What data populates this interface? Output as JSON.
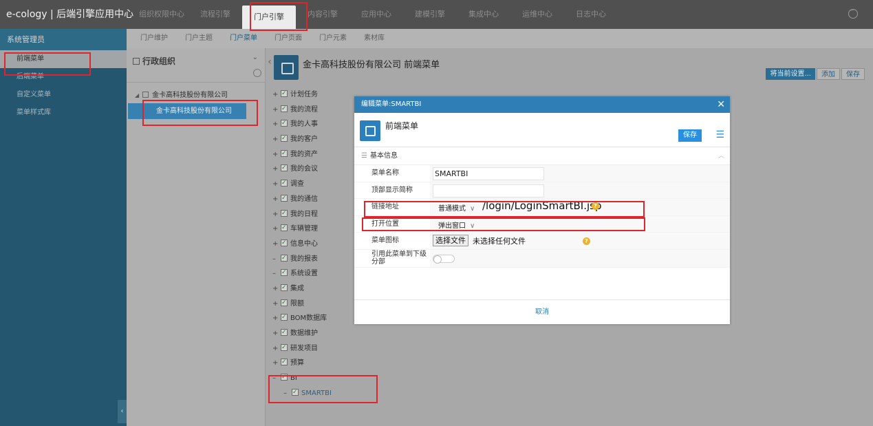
{
  "app": {
    "title": "e-cology | 后端引擎应用中心"
  },
  "topnav": {
    "tabs": [
      "组织权限中心",
      "流程引擎",
      "门户引擎",
      "内容引擎",
      "应用中心",
      "建模引擎",
      "集成中心",
      "运维中心",
      "日志中心"
    ],
    "active": "门户引擎"
  },
  "sidebar": {
    "title": "系统管理员",
    "items": [
      "前端菜单",
      "后端菜单",
      "自定义菜单",
      "菜单样式库"
    ]
  },
  "subnav": {
    "items": [
      "门户维护",
      "门户主题",
      "门户菜单",
      "门户页面",
      "门户元素",
      "素材库"
    ],
    "active": "门户菜单"
  },
  "org": {
    "title": "行政组织",
    "root": "金卡高科技股份有限公司",
    "selected": "金卡高科技股份有限公司"
  },
  "main": {
    "title": "金卡高科技股份有限公司 前端菜单",
    "buttons": [
      "将当前设置...",
      "添加",
      "保存"
    ]
  },
  "menu_tree": {
    "nodes": [
      {
        "pm": "+",
        "label": "计划任务"
      },
      {
        "pm": "+",
        "label": "我的流程"
      },
      {
        "pm": "+",
        "label": "我的人事"
      },
      {
        "pm": "+",
        "label": "我的客户"
      },
      {
        "pm": "+",
        "label": "我的资产"
      },
      {
        "pm": "+",
        "label": "我的会议"
      },
      {
        "pm": "+",
        "label": "调查"
      },
      {
        "pm": "+",
        "label": "我的通信"
      },
      {
        "pm": "+",
        "label": "我的日程"
      },
      {
        "pm": "+",
        "label": "车辆管理"
      },
      {
        "pm": "+",
        "label": "信息中心"
      },
      {
        "pm": "–",
        "label": "我的报表"
      },
      {
        "pm": "–",
        "label": "系统设置"
      },
      {
        "pm": "+",
        "label": "集成"
      },
      {
        "pm": "+",
        "label": "限额"
      },
      {
        "pm": "+",
        "label": "BOM数据库"
      },
      {
        "pm": "+",
        "label": "数据维护"
      },
      {
        "pm": "+",
        "label": "研发项目"
      },
      {
        "pm": "+",
        "label": "预算"
      },
      {
        "pm": "–",
        "label": "BI"
      }
    ],
    "child": {
      "pm": "–",
      "label": "SMARTBI"
    }
  },
  "modal": {
    "title": "编辑菜单:SMARTBI",
    "heading": "前端菜单",
    "save": "保存",
    "section": "基本信息",
    "fields": {
      "name_label": "菜单名称",
      "name_value": "SMARTBI",
      "topname_label": "顶部显示简称",
      "topname_value": "",
      "link_label": "链接地址",
      "link_mode": "普通模式",
      "link_value": "/login/LoginSmartBI.jsp",
      "open_label": "打开位置",
      "open_value": "弹出窗口",
      "icon_label": "菜单图标",
      "file_button": "选择文件",
      "file_status": "未选择任何文件",
      "ref_label": "引用此菜单到下级分部"
    },
    "cancel": "取消"
  }
}
